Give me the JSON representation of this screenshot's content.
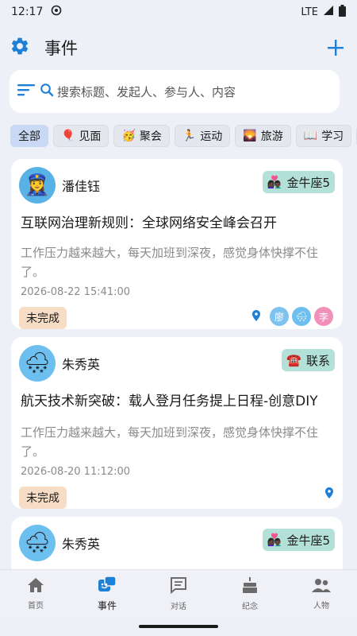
{
  "status_bar": {
    "time": "12:17",
    "network": "LTE"
  },
  "header": {
    "title": "事件"
  },
  "search": {
    "placeholder": "搜索标题、发起人、参与人、内容"
  },
  "filters": [
    {
      "label": "全部",
      "emoji": ""
    },
    {
      "label": "见面",
      "emoji": "🎈"
    },
    {
      "label": "聚会",
      "emoji": "🥳"
    },
    {
      "label": "运动",
      "emoji": "🏃"
    },
    {
      "label": "旅游",
      "emoji": "🌄"
    },
    {
      "label": "学习",
      "emoji": "📖"
    },
    {
      "label": "",
      "emoji": "💼"
    }
  ],
  "events": [
    {
      "user": "潘佳钰",
      "avatar": "👮‍♀️",
      "tag": {
        "emoji": "👩🏿‍❤️‍👨🏿",
        "label": "金牛座5"
      },
      "title": "互联网治理新规则：全球网络安全峰会召开",
      "body": "工作压力越来越大，每天加班到深夜，感觉身体快撑不住了。",
      "time": "2026-08-22 15:41:00",
      "status": "未完成",
      "participants": [
        {
          "text": "廖",
          "color": "#7ec3ef"
        },
        {
          "text": "🌨",
          "color": "#6cbfef"
        },
        {
          "text": "李",
          "color": "#f08fb8"
        }
      ]
    },
    {
      "user": "朱秀英",
      "avatar": "🌨",
      "tag": {
        "emoji": "☎️",
        "label": "联系"
      },
      "title": "航天技术新突破：载人登月任务提上日程-创意DIY",
      "body": "工作压力越来越大，每天加班到深夜，感觉身体快撑不住了。",
      "time": "2026-08-20 11:12:00",
      "status": "未完成",
      "participants": []
    },
    {
      "user": "朱秀英",
      "avatar": "🌨",
      "tag": {
        "emoji": "👩🏿‍❤️‍👨🏿",
        "label": "金牛座5"
      }
    }
  ],
  "bottom_nav": [
    {
      "label": "首页",
      "icon": "home-icon"
    },
    {
      "label": "事件",
      "icon": "events-icon"
    },
    {
      "label": "对话",
      "icon": "chat-icon"
    },
    {
      "label": "纪念",
      "icon": "cake-icon"
    },
    {
      "label": "人物",
      "icon": "people-icon"
    }
  ],
  "colors": {
    "accent": "#1e7fd6",
    "tag_bg": "#b3e1d8",
    "status_bg": "#f7dcc6",
    "active_chip": "#c9d8f4"
  }
}
